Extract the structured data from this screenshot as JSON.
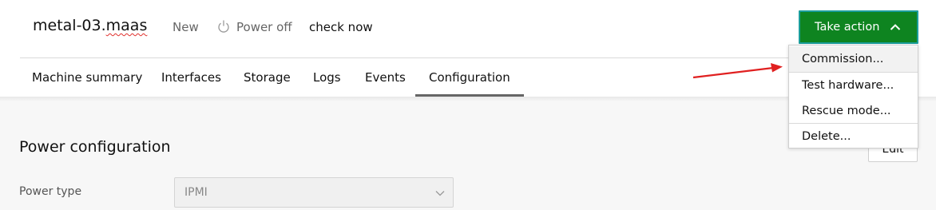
{
  "header": {
    "machine_name_prefix": "metal-03.",
    "machine_name_suffix": "maas",
    "status_new": "New",
    "power_status": "Power off",
    "check_now": "check now",
    "take_action_label": "Take action"
  },
  "tabs": [
    {
      "label": "Machine summary"
    },
    {
      "label": "Interfaces"
    },
    {
      "label": "Storage"
    },
    {
      "label": "Logs"
    },
    {
      "label": "Events"
    },
    {
      "label": "Configuration",
      "active": true
    }
  ],
  "dropdown": {
    "items": [
      {
        "label": "Commission..."
      },
      {
        "label": "Test hardware..."
      },
      {
        "label": "Rescue mode..."
      },
      {
        "label": "Delete..."
      }
    ]
  },
  "power_configuration": {
    "title": "Power configuration",
    "edit_label": "Edit",
    "power_type_label": "Power type",
    "power_type_value": "IPMI"
  },
  "colors": {
    "accent_green": "#0e8420",
    "focus_border": "#1b9e9c",
    "annotation_arrow": "#e02020"
  }
}
